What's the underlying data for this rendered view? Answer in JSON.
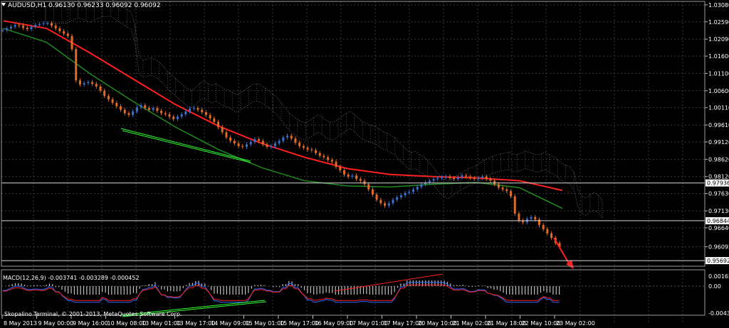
{
  "window": {
    "symbol_line": "AUDUSD,H1  0.96130 0.96233 0.96092 0.96092",
    "copyright": "Skopalino Terminal, © 2001-2013, MetaQuotes Software Corp."
  },
  "colors": {
    "background": "#000000",
    "grid": "#3a3a3a",
    "bull_candle": "#3b6fd1",
    "bear_candle": "#e06a28",
    "ma_red": "#ff2020",
    "ma_green": "#1f8a1f",
    "ichimoku_cloud": "#c9c9c9",
    "trend_green": "#33ff33",
    "macd_hist": "#c0c0c0",
    "macd_line": "#2a6cff",
    "macd_signal": "#ff2020"
  },
  "price_axis": {
    "labels": [
      "1.03080",
      "1.02590",
      "1.02090",
      "1.01600",
      "1.01100",
      "1.00600",
      "1.00110",
      "0.99610",
      "0.99120",
      "0.98620",
      "0.98120",
      "0.97630",
      "0.97130",
      "0.96640",
      "0.96092"
    ],
    "highlighted": [
      "0.97936",
      "0.96844",
      "0.95692"
    ],
    "current": "0.96092"
  },
  "macd": {
    "label": "MACD(12,26,9) -0.003741 -0.003289 -0.000452",
    "axis_labels": [
      "0.001658",
      "0.00",
      "-0.004397"
    ]
  },
  "time_axis": {
    "labels": [
      "8 May 2013",
      "9 May 00:00",
      "9 May 16:00",
      "10 May 08:00",
      "13 May 01:00",
      "13 May 17:00",
      "14 May 09:00",
      "15 May 01:00",
      "15 May 17:00",
      "16 May 09:00",
      "17 May 01:00",
      "17 May 17:00",
      "20 May 10:00",
      "21 May 02:00",
      "21 May 18:00",
      "22 May 10:00",
      "23 May 02:00"
    ]
  },
  "chart_data": {
    "type": "candlestick",
    "symbol": "AUDUSD",
    "timeframe": "H1",
    "ohlc_last": {
      "open": 0.9613,
      "high": 0.96233,
      "low": 0.96092,
      "close": 0.96092
    },
    "ylim": [
      0.9553,
      1.0318
    ],
    "close_path": [
      1.0235,
      1.024,
      1.0245,
      1.025,
      1.0248,
      1.0242,
      1.0238,
      1.0245,
      1.025,
      1.0253,
      1.0255,
      1.0255,
      1.0248,
      1.024,
      1.0232,
      1.0225,
      1.0218,
      1.018,
      1.009,
      1.0078,
      1.0082,
      1.0085,
      1.008,
      1.0072,
      1.006,
      1.0045,
      1.0035,
      1.0025,
      1.0015,
      1.0005,
      0.9995,
      0.999,
      1.0,
      1.0012,
      1.0018,
      1.001,
      1.0005,
      1.001,
      1.0002,
      0.9995,
      0.9992,
      0.9985,
      0.9978,
      0.9985,
      0.9992,
      1.0,
      1.0008,
      1.001,
      1.0005,
      0.9998,
      0.999,
      0.998,
      0.997,
      0.9955,
      0.994,
      0.9925,
      0.9915,
      0.9908,
      0.99,
      0.9898,
      0.9905,
      0.9912,
      0.992,
      0.9915,
      0.9905,
      0.9898,
      0.99,
      0.9908,
      0.9915,
      0.9925,
      0.993,
      0.9922,
      0.991,
      0.99,
      0.9895,
      0.989,
      0.9888,
      0.988,
      0.9872,
      0.9868,
      0.986,
      0.9855,
      0.984,
      0.983,
      0.9818,
      0.9812,
      0.9815,
      0.9805,
      0.98,
      0.979,
      0.9775,
      0.976,
      0.9745,
      0.9735,
      0.9728,
      0.9735,
      0.9745,
      0.9752,
      0.9758,
      0.9765,
      0.9768,
      0.9775,
      0.9782,
      0.979,
      0.9795,
      0.98,
      0.9805,
      0.9808,
      0.981,
      0.9812,
      0.9808,
      0.9805,
      0.981,
      0.9815,
      0.9812,
      0.9808,
      0.9805,
      0.9808,
      0.9812,
      0.9805,
      0.98,
      0.979,
      0.978,
      0.9775,
      0.977,
      0.9755,
      0.9705,
      0.9685,
      0.968,
      0.969,
      0.9695,
      0.9688,
      0.9672,
      0.966,
      0.9648,
      0.9635,
      0.962,
      0.9609
    ],
    "series": [
      {
        "name": "MA red",
        "values": [
          1.0262,
          1.024,
          1.017,
          1.0095,
          1.002,
          0.9958,
          0.9908,
          0.9868,
          0.9835,
          0.9818,
          0.9812,
          0.9808,
          0.98,
          0.9772
        ]
      },
      {
        "name": "MA green",
        "values": [
          1.024,
          1.02,
          1.011,
          1.003,
          0.9955,
          0.989,
          0.9838,
          0.98,
          0.9785,
          0.9782,
          0.979,
          0.9795,
          0.978,
          0.972
        ]
      }
    ]
  }
}
